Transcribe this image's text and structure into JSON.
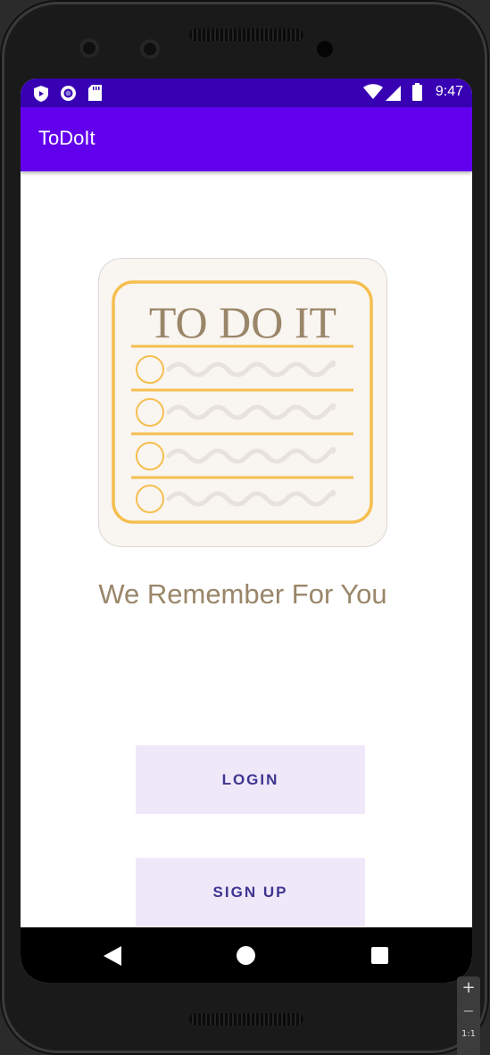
{
  "status_bar": {
    "time": "9:47",
    "left_icons": [
      "shield-play-icon",
      "record-icon",
      "sd-card-icon"
    ],
    "right_icons": [
      "wifi-icon",
      "signal-icon",
      "battery-icon"
    ]
  },
  "app_bar": {
    "title": "ToDoIt"
  },
  "logo": {
    "text": "TO DO IT"
  },
  "tagline": "We Remember For You",
  "buttons": {
    "login": "LOGIN",
    "signup": "SIGN UP"
  },
  "nav_bar": {
    "buttons": [
      "back-icon",
      "home-icon",
      "recents-icon"
    ]
  },
  "emulator_controls": {
    "zoom_in": "+",
    "zoom_out": "−",
    "actual_size": "1:1"
  },
  "colors": {
    "status_bar": "#3700b3",
    "app_bar": "#6200ee",
    "accent_yellow": "#f5bf4f",
    "tagline": "#9a8669",
    "button_bg": "#efe8f9",
    "button_text": "#3e3590"
  }
}
